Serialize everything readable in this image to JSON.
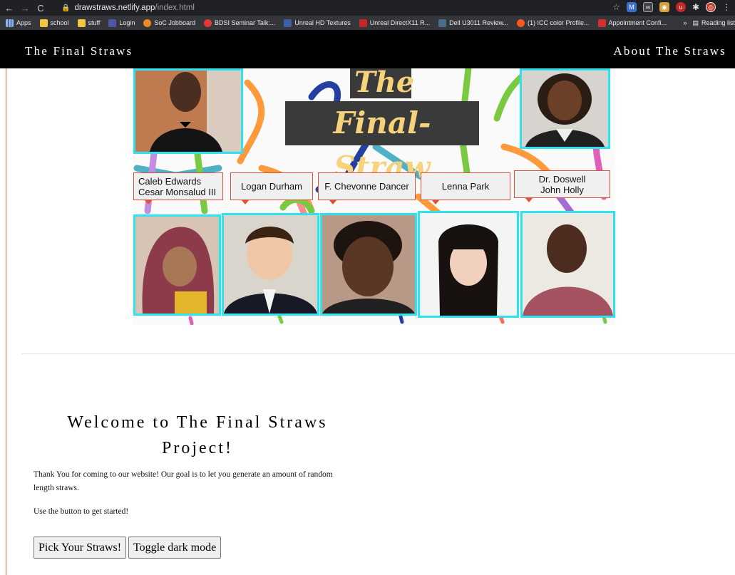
{
  "browser": {
    "url_host": "drawstraws.netlify.app",
    "url_path": "/index.html",
    "bookmarks": [
      "Apps",
      "school",
      "stuff",
      "Login",
      "SoC Jobboard",
      "BDSI Seminar Talk:...",
      "Unreal HD Textures",
      "Unreal DirectX11 R...",
      "Dell U3011 Review...",
      "(1) ICC color Profile...",
      "Appointment Confi..."
    ],
    "overflow": "»",
    "reading_list": "Reading list"
  },
  "navbar": {
    "brand": "The Final Straws",
    "about": "About The Straws"
  },
  "hero": {
    "title_line1": "The",
    "title_line2": "Final-Straw",
    "labels": [
      {
        "line1": "Caleb Edwards",
        "line2": "Cesar Monsalud III"
      },
      {
        "line1": "Logan Durham",
        "line2": ""
      },
      {
        "line1": "F. Chevonne Dancer",
        "line2": ""
      },
      {
        "line1": "Lenna Park",
        "line2": ""
      },
      {
        "line1": "Dr. Doswell",
        "line2": "John Holly"
      }
    ]
  },
  "welcome": {
    "heading": "Welcome to The Final Straws Project!",
    "paragraph1": "Thank You for coming to our website! Our goal is to let you generate an amount of random length straws.",
    "paragraph2": "Use the button to get started!",
    "pick_button": "Pick Your Straws!",
    "dark_button": "Toggle dark mode"
  },
  "colors": {
    "photo_border": "#2de3f0",
    "label_border": "#d9533c",
    "title_text": "#f6d37a",
    "title_bg": "#3a3a3a",
    "navbar_bg": "#000000"
  }
}
